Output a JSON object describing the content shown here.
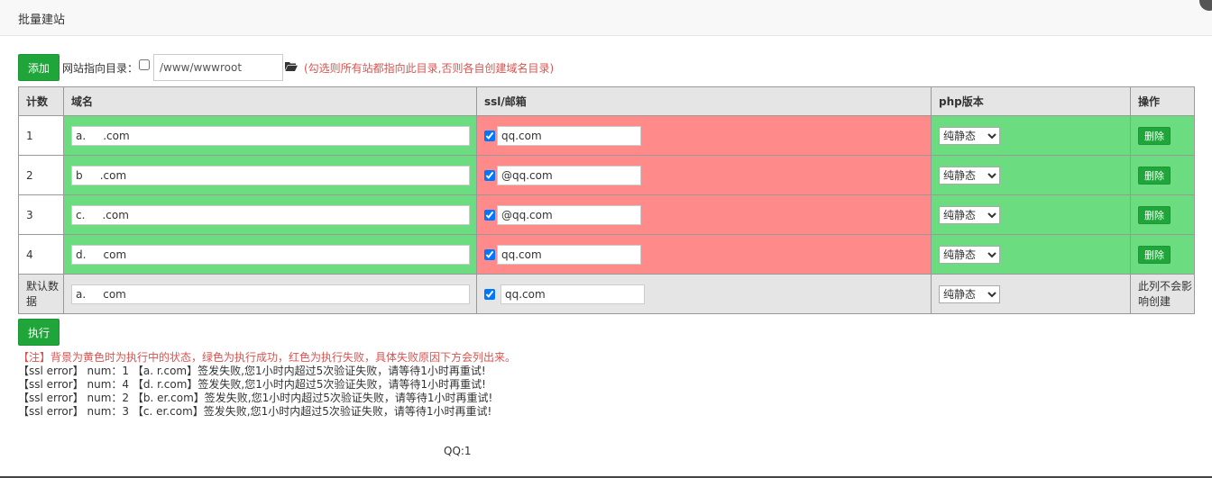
{
  "dialog": {
    "title": "批量建站"
  },
  "toolbar": {
    "add_label": "添加",
    "dir_label": "网站指向目录：",
    "dir_checked": false,
    "dir_value": "/www/wwwroot",
    "dir_hint": "(勾选则所有站都指向此目录,否则各自创建域名目录)",
    "folder_icon": "folder-open-icon"
  },
  "table": {
    "headers": {
      "count": "计数",
      "domain": "域名",
      "ssl": "ssl/邮箱",
      "php": "php版本",
      "action": "操作"
    },
    "rows": [
      {
        "count": "1",
        "domain": "a.     .com",
        "ssl_checked": true,
        "email": "qq.com",
        "php": "纯静态",
        "delete_label": "删除"
      },
      {
        "count": "2",
        "domain": "b     .com",
        "ssl_checked": true,
        "email": "@qq.com",
        "php": "纯静态",
        "delete_label": "删除"
      },
      {
        "count": "3",
        "domain": "c.     .com",
        "ssl_checked": true,
        "email": "@qq.com",
        "php": "纯静态",
        "delete_label": "删除"
      },
      {
        "count": "4",
        "domain": "d.     com",
        "ssl_checked": true,
        "email": "qq.com",
        "php": "纯静态",
        "delete_label": "删除"
      }
    ],
    "default_row": {
      "label": "默认数据",
      "domain": "a.     com",
      "ssl_checked": true,
      "email": "qq.com",
      "php": "纯静态",
      "note": "此列不会影响创建"
    },
    "php_options": [
      "纯静态"
    ]
  },
  "execute_label": "执行",
  "note": "【注】背景为黄色时为执行中的状态，绿色为执行成功，红色为执行失败，具体失败原因下方会列出来。",
  "logs": [
    "【ssl error】 num：1 【a.     r.com】签发失败,您1小时内超过5次验证失败，请等待1小时再重试!",
    "【ssl error】 num：4 【d.     r.com】签发失败,您1小时内超过5次验证失败，请等待1小时再重试!",
    "【ssl error】 num：2 【b.     er.com】签发失败,您1小时内超过5次验证失败，请等待1小时再重试!",
    "【ssl error】 num：3 【c.     er.com】签发失败,您1小时内超过5次验证失败，请等待1小时再重试!"
  ],
  "footer": {
    "text": "QQ:1"
  },
  "colors": {
    "success": "#6bdc7f",
    "failure": "#ff8a8a",
    "button": "#20a53a",
    "warning": "#d9534f"
  }
}
